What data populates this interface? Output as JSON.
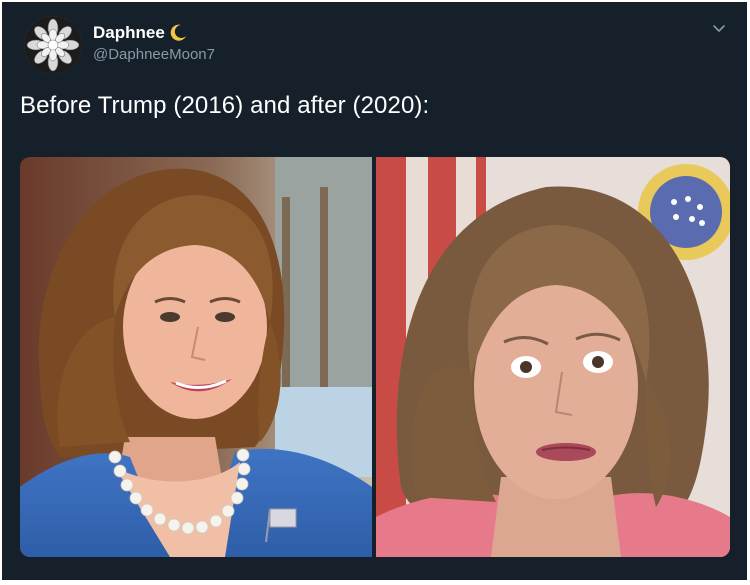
{
  "tweet": {
    "author": {
      "display_name": "Daphnee",
      "name_emoji": "crescent-moon-icon",
      "handle": "@DaphneeMoon7"
    },
    "text": "Before Trump (2016) and after (2020):",
    "menu_icon": "chevron-down-icon",
    "media": {
      "left_photo": "portrait-before-icon",
      "right_photo": "portrait-after-icon"
    }
  },
  "colors": {
    "background": "#15202b",
    "text_primary": "#ffffff",
    "text_secondary": "#8899a6",
    "moon_yellow": "#f4c542"
  }
}
